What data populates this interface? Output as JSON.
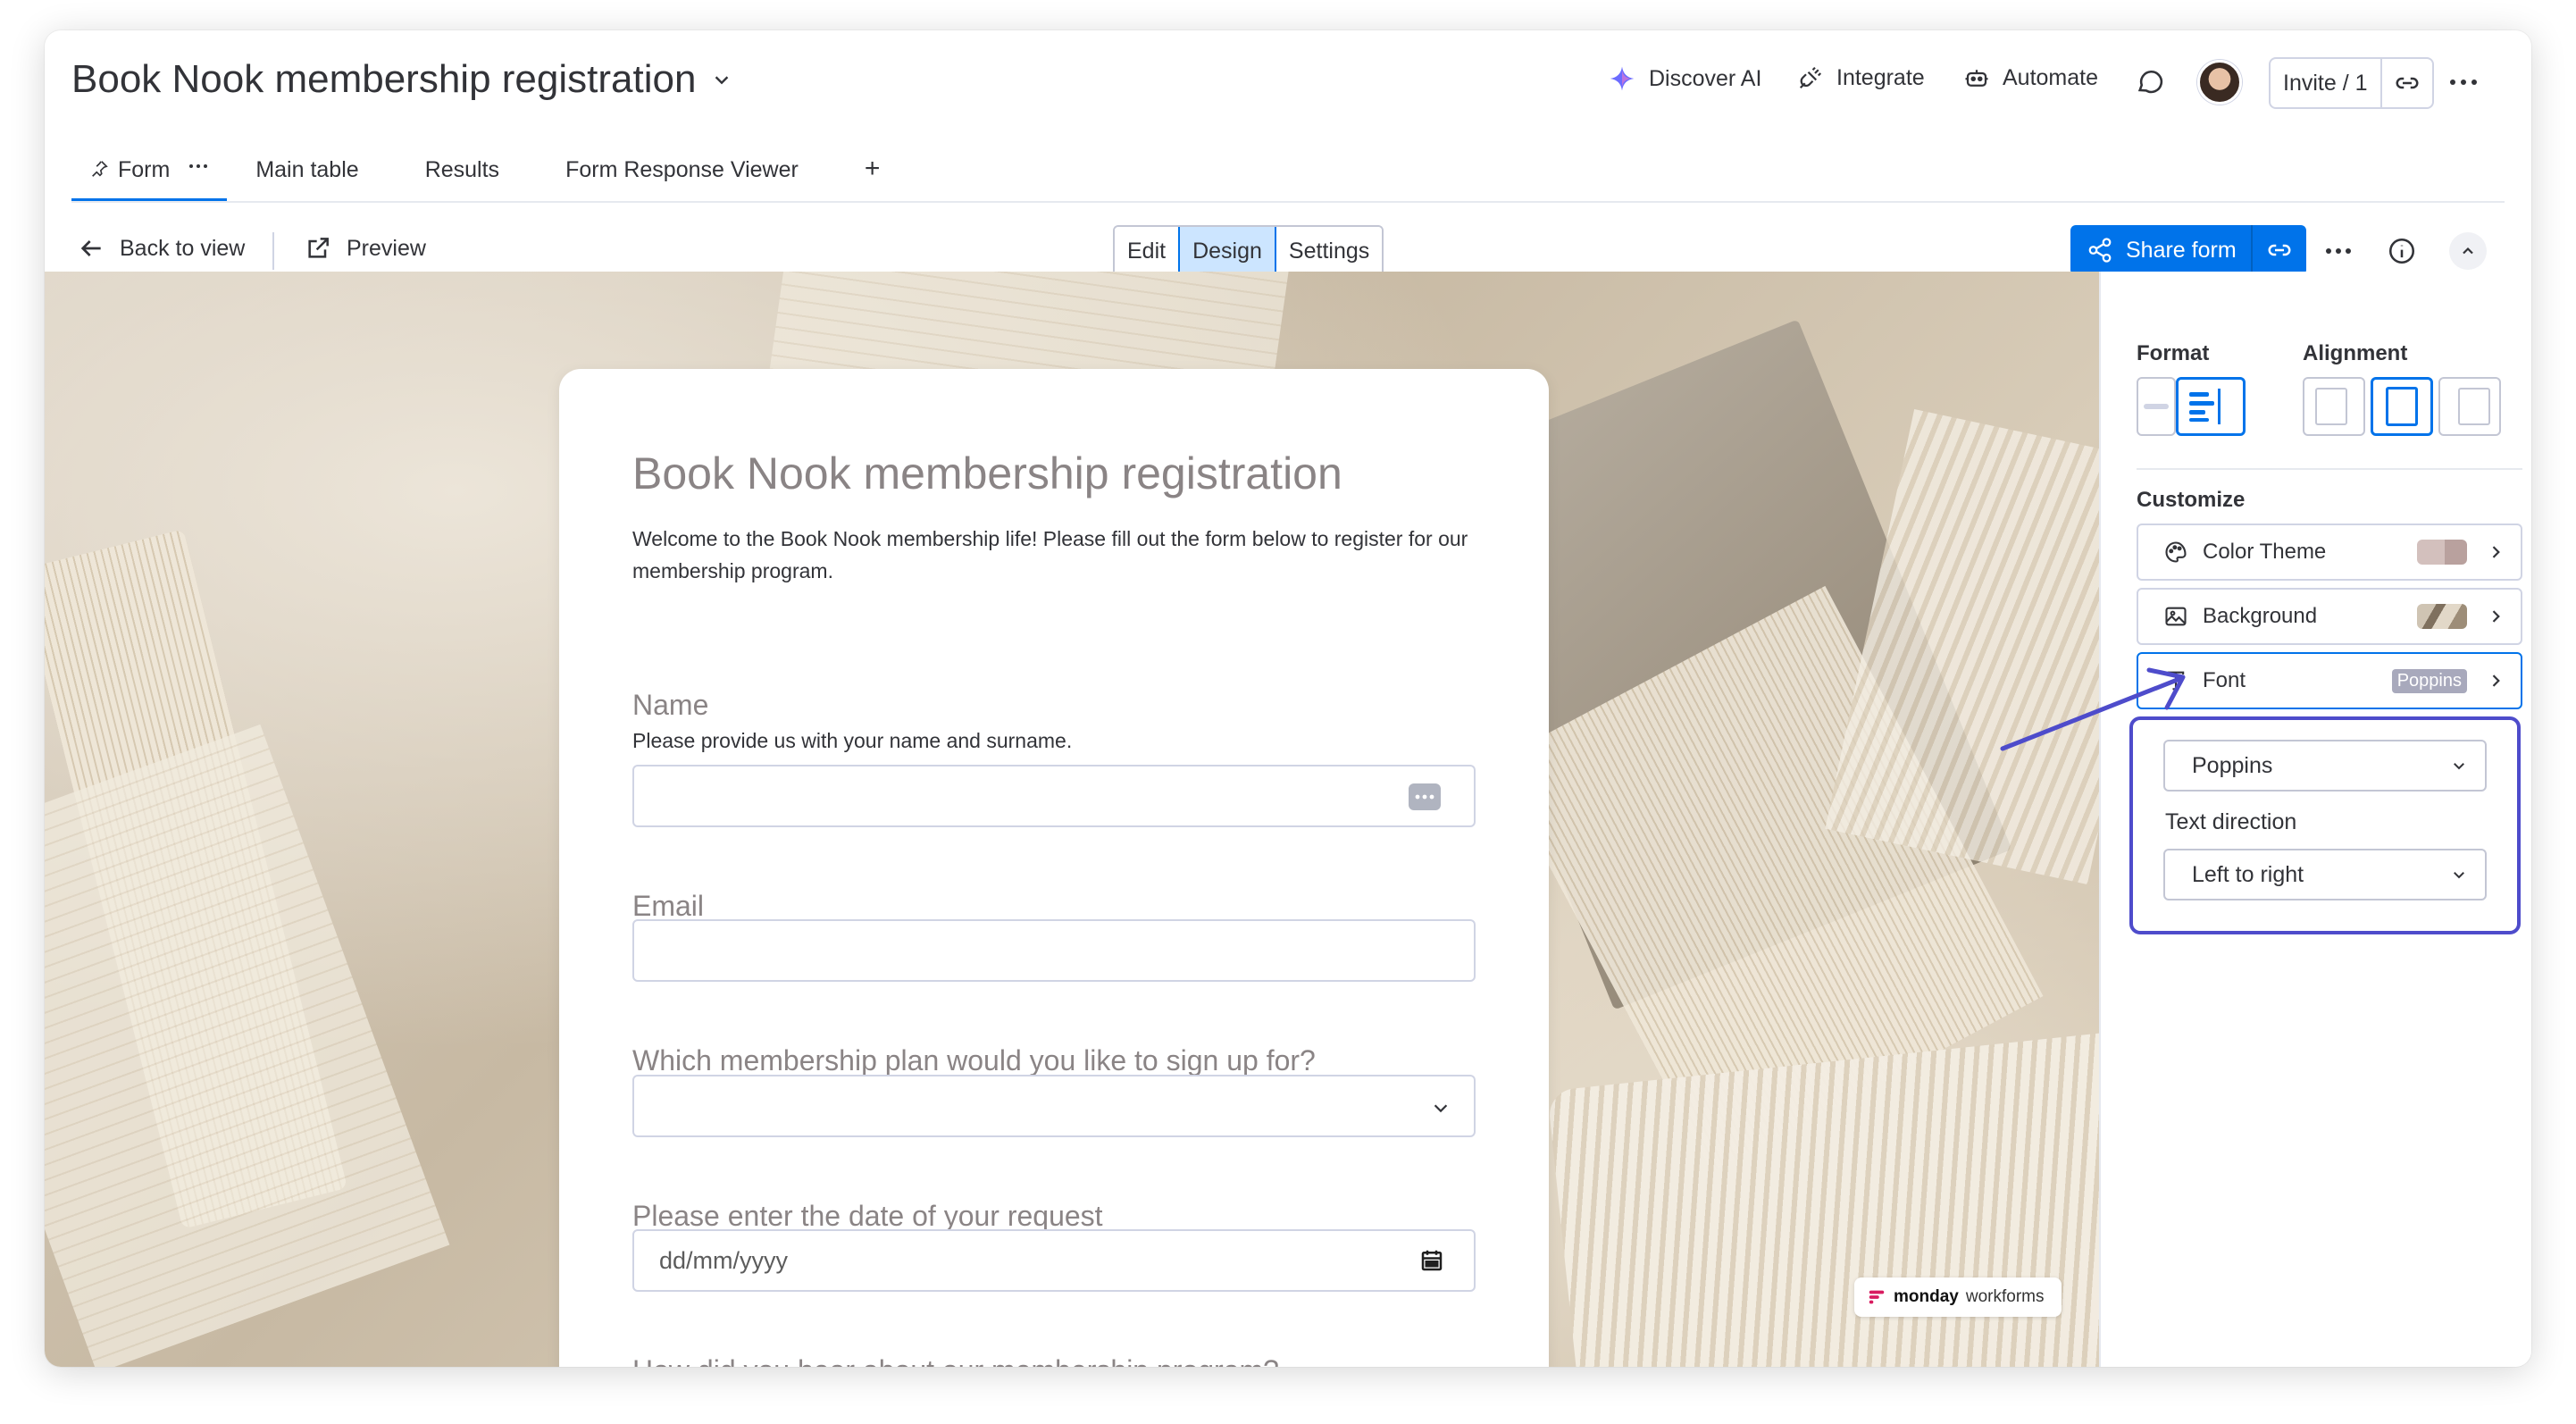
{
  "header": {
    "board_title": "Book Nook membership registration",
    "actions": {
      "discover_ai": "Discover AI",
      "integrate": "Integrate",
      "automate": "Automate"
    },
    "invite_label": "Invite / 1"
  },
  "tabs": {
    "form": "Form",
    "main_table": "Main table",
    "results": "Results",
    "form_response_viewer": "Form Response Viewer",
    "add": "+"
  },
  "toolbar": {
    "back_to_view": "Back to view",
    "preview": "Preview",
    "modes": {
      "edit": "Edit",
      "design": "Design",
      "settings": "Settings"
    },
    "active_mode": "Design",
    "share_form": "Share form"
  },
  "form": {
    "title": "Book Nook membership registration",
    "description": "Welcome to the Book Nook membership life! Please fill out the form below to register for our membership program.",
    "questions": {
      "name": {
        "label": "Name",
        "help": "Please provide us with your name and surname."
      },
      "email": {
        "label": "Email"
      },
      "plan": {
        "label": "Which membership plan would you like to sign up for?"
      },
      "date": {
        "label": "Please enter the date of your request",
        "placeholder": "dd/mm/yyyy"
      },
      "source": {
        "label": "How did you hear about our membership program?"
      }
    }
  },
  "watermark": {
    "brand": "monday",
    "product": "workforms"
  },
  "design_panel": {
    "format_label": "Format",
    "alignment_label": "Alignment",
    "customize_label": "Customize",
    "rows": {
      "color_theme": "Color Theme",
      "background": "Background",
      "font": "Font",
      "font_value": "Poppins"
    },
    "font_dropdown": "Poppins",
    "text_direction_label": "Text direction",
    "text_direction_value": "Left to right"
  },
  "colors": {
    "accent_blue": "#0073ea",
    "highlight_purple": "#4e4ccb",
    "question_label": "#8a8485",
    "color_theme_swatch": "#c9a9a6"
  }
}
